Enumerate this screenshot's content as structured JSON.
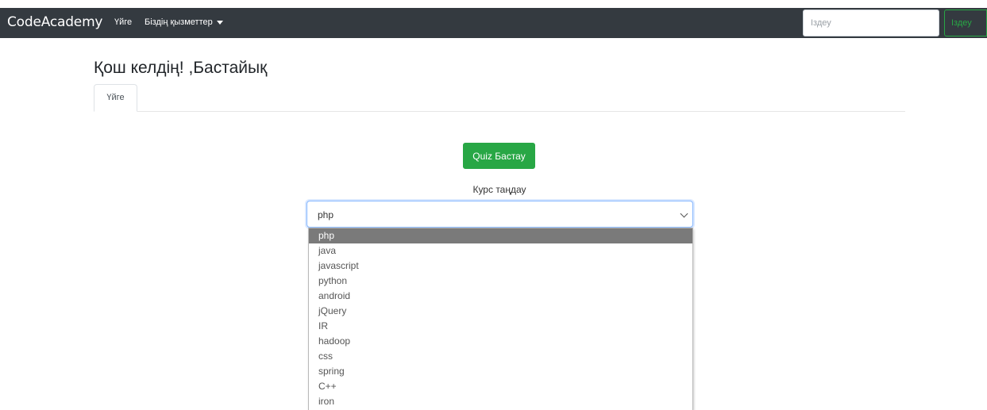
{
  "navbar": {
    "brand": "CodeAcademy",
    "home": "Үйге",
    "services": "Біздің қызметтер",
    "search_placeholder": "Іздеу",
    "search_button": "Іздеу"
  },
  "header": {
    "title": "Қош келдің! ,Бастайық"
  },
  "tabs": [
    {
      "label": "Үйге",
      "active": true
    }
  ],
  "main": {
    "start_quiz_button": "Quiz Бастау",
    "course_label": "Курс таңдау",
    "course_select": {
      "selected": "php",
      "options": [
        "php",
        "java",
        "javascript",
        "python",
        "android",
        "jQuery",
        "IR",
        "hadoop",
        "css",
        "spring",
        "C++",
        "iron"
      ]
    }
  },
  "colors": {
    "navbar_bg": "#343a40",
    "success": "#28a745",
    "option_highlight": "#7a7a7a"
  },
  "icons": {
    "dropdown_caret": "caret-down-icon",
    "select_chevron": "chevron-down-icon"
  }
}
